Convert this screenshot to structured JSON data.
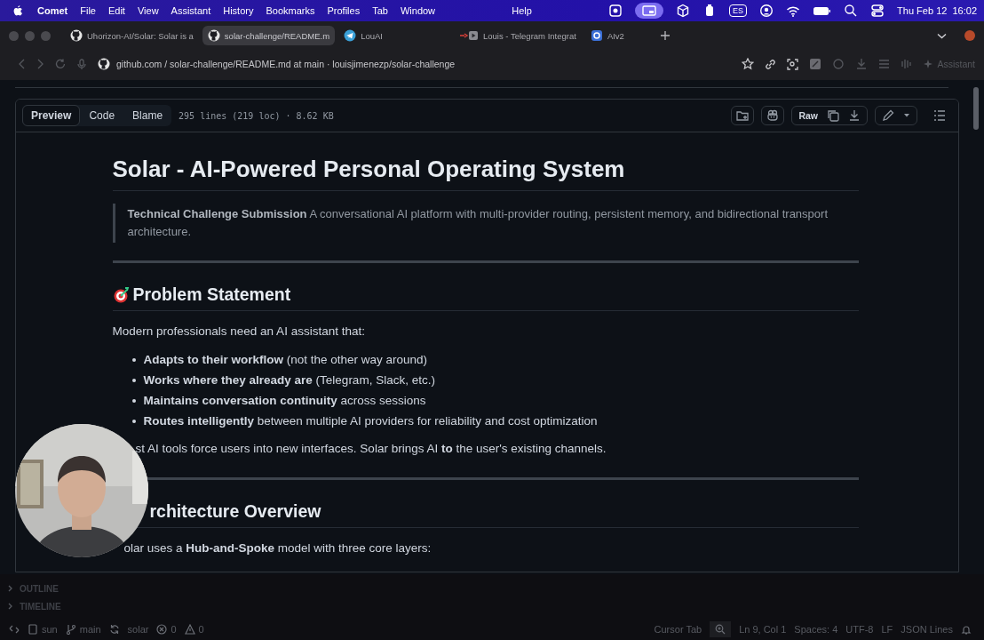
{
  "menu_bar": {
    "app": "Comet",
    "menus": [
      "File",
      "Edit",
      "View",
      "Assistant",
      "History",
      "Bookmarks",
      "Profiles",
      "Tab",
      "Window"
    ],
    "help": "Help",
    "input_source": "ES",
    "clock": "Thu Feb 12  16:02"
  },
  "tabs": [
    {
      "title": "Uhorizon-AI/Solar: Solar is a",
      "kind": "github",
      "selected": false
    },
    {
      "title": "solar-challenge/README.m",
      "kind": "github",
      "selected": true
    },
    {
      "title": "LouAI",
      "kind": "telegram",
      "selected": false
    },
    {
      "title": "Louis - Telegram Integrat",
      "kind": "media",
      "selected": false
    },
    {
      "title": "AIv2",
      "kind": "app",
      "selected": false
    }
  ],
  "address_bar": {
    "url": "github.com / solar-challenge/README.md at main · louisjimenezp/solar-challenge",
    "assistant": "Assistant"
  },
  "file_toolbar": {
    "views": [
      {
        "label": "Preview",
        "selected": true
      },
      {
        "label": "Code",
        "selected": false
      },
      {
        "label": "Blame",
        "selected": false
      }
    ],
    "info": "295 lines (219 loc) · 8.62 KB",
    "raw": "Raw"
  },
  "readme": {
    "title": "Solar - AI-Powered Personal Operating System",
    "quote": "**Technical Challenge Submission** A conversational AI platform with multi-provider routing, persistent memory, and bidirectional transport architecture.",
    "sections": [
      {
        "heading": "Problem Statement",
        "emoji": true,
        "intro": "Modern professionals need an AI assistant that:",
        "bullets": [
          "**Adapts to their workflow** (not the other way around)",
          "**Works where they already are** (Telegram, Slack, etc.)",
          "**Maintains conversation continuity** across sessions",
          "**Routes intelligently** between multiple AI providers for reliability and cost optimization"
        ],
        "outro": "st AI tools force users into new interfaces. Solar brings AI **to** the user's existing channels."
      },
      {
        "heading": "rchitecture Overview",
        "emoji": false,
        "intro": "olar uses a **Hub-and-Spoke** model with three core layers:"
      }
    ]
  },
  "side_panels": [
    {
      "label": "OUTLINE",
      "expanded": false
    },
    {
      "label": "TIMELINE",
      "expanded": false
    }
  ],
  "status_bar": {
    "left": [
      {
        "kind": "host",
        "text": "sun"
      },
      {
        "kind": "branch",
        "text": "main"
      },
      {
        "kind": "sync"
      },
      {
        "kind": "plain",
        "text": "solar"
      },
      {
        "kind": "errors",
        "text": "0"
      },
      {
        "kind": "warnings",
        "text": "0"
      }
    ],
    "right": [
      {
        "kind": "plain",
        "text": "Cursor Tab"
      },
      {
        "kind": "zoom"
      },
      {
        "kind": "plain",
        "text": "Ln 9, Col 1"
      },
      {
        "kind": "plain",
        "text": "Spaces: 4"
      },
      {
        "kind": "plain",
        "text": "UTF-8"
      },
      {
        "kind": "plain",
        "text": "LF"
      },
      {
        "kind": "plain",
        "text": "JSON Lines"
      },
      {
        "kind": "bell"
      }
    ]
  }
}
